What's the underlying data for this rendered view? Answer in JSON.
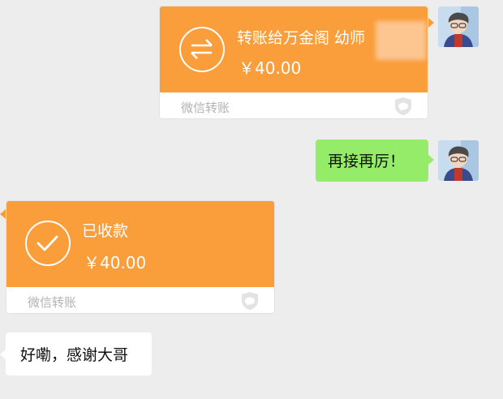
{
  "messages": {
    "transfer_sent": {
      "title": "转账给万金阁 幼师",
      "amount": "￥40.00",
      "footer": "微信转账",
      "icon": "transfer-arrows-icon"
    },
    "text_sent": {
      "text": "再接再厉！"
    },
    "transfer_received": {
      "title": "已收款",
      "amount": "￥40.00",
      "footer": "微信转账",
      "icon": "checkmark-icon"
    },
    "text_received": {
      "text": "好嘞，感谢大哥"
    }
  },
  "colors": {
    "transfer_orange": "#fa9d3b",
    "sent_bubble_green": "#95ec69",
    "background": "#ededed"
  }
}
